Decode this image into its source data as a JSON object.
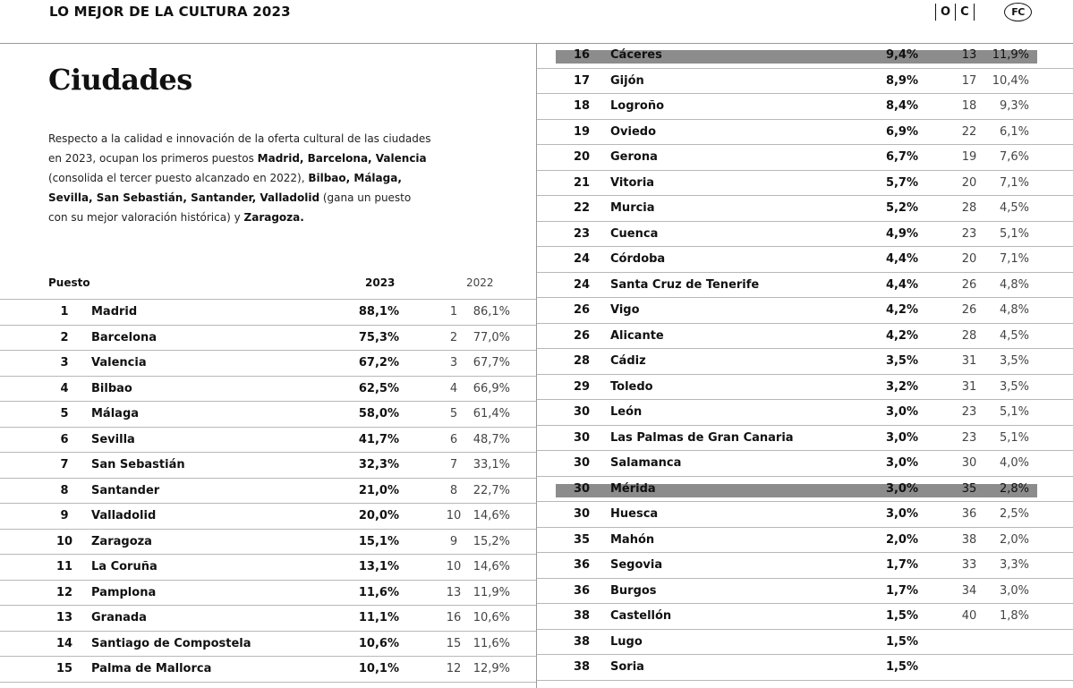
{
  "header": {
    "title": "LO MEJOR DE LA CULTURA 2023",
    "logo_occ": [
      "O",
      "C"
    ],
    "logo_fc": "FC"
  },
  "page": {
    "title": "Ciudades",
    "intro": [
      {
        "t": "Respecto a la calidad e innovación de la oferta cultural de las ciudades en 2023, ocupan los primeros puestos ",
        "b": false
      },
      {
        "t": "Madrid, Barcelona, Valencia",
        "b": true
      },
      {
        "t": " (consolida el tercer puesto alcanzado en 2022), ",
        "b": false
      },
      {
        "t": "Bilbao, Málaga, Sevilla, San Sebastián, Santander, Valladolid",
        "b": true
      },
      {
        "t": " (gana un puesto con su mejor valoración histórica) y ",
        "b": false
      },
      {
        "t": "Zaragoza.",
        "b": true
      }
    ]
  },
  "table": {
    "headers": {
      "rank": "Puesto",
      "y2023": "2023",
      "y2022": "2022"
    },
    "left": [
      {
        "rank": "1",
        "city": "Madrid",
        "pct": "88,1%",
        "prank": "1",
        "ppct": "86,1%"
      },
      {
        "rank": "2",
        "city": "Barcelona",
        "pct": "75,3%",
        "prank": "2",
        "ppct": "77,0%"
      },
      {
        "rank": "3",
        "city": "Valencia",
        "pct": "67,2%",
        "prank": "3",
        "ppct": "67,7%"
      },
      {
        "rank": "4",
        "city": "Bilbao",
        "pct": "62,5%",
        "prank": "4",
        "ppct": "66,9%"
      },
      {
        "rank": "5",
        "city": "Málaga",
        "pct": "58,0%",
        "prank": "5",
        "ppct": "61,4%"
      },
      {
        "rank": "6",
        "city": "Sevilla",
        "pct": "41,7%",
        "prank": "6",
        "ppct": "48,7%"
      },
      {
        "rank": "7",
        "city": "San Sebastián",
        "pct": "32,3%",
        "prank": "7",
        "ppct": "33,1%"
      },
      {
        "rank": "8",
        "city": "Santander",
        "pct": "21,0%",
        "prank": "8",
        "ppct": "22,7%"
      },
      {
        "rank": "9",
        "city": "Valladolid",
        "pct": "20,0%",
        "prank": "10",
        "ppct": "14,6%"
      },
      {
        "rank": "10",
        "city": "Zaragoza",
        "pct": "15,1%",
        "prank": "9",
        "ppct": "15,2%"
      },
      {
        "rank": "11",
        "city": "La Coruña",
        "pct": "13,1%",
        "prank": "10",
        "ppct": "14,6%"
      },
      {
        "rank": "12",
        "city": "Pamplona",
        "pct": "11,6%",
        "prank": "13",
        "ppct": "11,9%"
      },
      {
        "rank": "13",
        "city": "Granada",
        "pct": "11,1%",
        "prank": "16",
        "ppct": "10,6%"
      },
      {
        "rank": "14",
        "city": "Santiago de Compostela",
        "pct": "10,6%",
        "prank": "15",
        "ppct": "11,6%"
      },
      {
        "rank": "15",
        "city": "Palma de Mallorca",
        "pct": "10,1%",
        "prank": "12",
        "ppct": "12,9%"
      }
    ],
    "right": [
      {
        "rank": "16",
        "city": "Cáceres",
        "pct": "9,4%",
        "prank": "13",
        "ppct": "11,9%",
        "highlight": true
      },
      {
        "rank": "17",
        "city": "Gijón",
        "pct": "8,9%",
        "prank": "17",
        "ppct": "10,4%"
      },
      {
        "rank": "18",
        "city": "Logroño",
        "pct": "8,4%",
        "prank": "18",
        "ppct": "9,3%"
      },
      {
        "rank": "19",
        "city": "Oviedo",
        "pct": "6,9%",
        "prank": "22",
        "ppct": "6,1%"
      },
      {
        "rank": "20",
        "city": "Gerona",
        "pct": "6,7%",
        "prank": "19",
        "ppct": "7,6%"
      },
      {
        "rank": "21",
        "city": "Vitoria",
        "pct": "5,7%",
        "prank": "20",
        "ppct": "7,1%"
      },
      {
        "rank": "22",
        "city": "Murcia",
        "pct": "5,2%",
        "prank": "28",
        "ppct": "4,5%"
      },
      {
        "rank": "23",
        "city": "Cuenca",
        "pct": "4,9%",
        "prank": "23",
        "ppct": "5,1%"
      },
      {
        "rank": "24",
        "city": "Córdoba",
        "pct": "4,4%",
        "prank": "20",
        "ppct": "7,1%"
      },
      {
        "rank": "24",
        "city": "Santa Cruz de Tenerife",
        "pct": "4,4%",
        "prank": "26",
        "ppct": "4,8%"
      },
      {
        "rank": "26",
        "city": "Vigo",
        "pct": "4,2%",
        "prank": "26",
        "ppct": "4,8%"
      },
      {
        "rank": "26",
        "city": "Alicante",
        "pct": "4,2%",
        "prank": "28",
        "ppct": "4,5%"
      },
      {
        "rank": "28",
        "city": "Cádiz",
        "pct": "3,5%",
        "prank": "31",
        "ppct": "3,5%"
      },
      {
        "rank": "29",
        "city": "Toledo",
        "pct": "3,2%",
        "prank": "31",
        "ppct": "3,5%"
      },
      {
        "rank": "30",
        "city": "León",
        "pct": "3,0%",
        "prank": "23",
        "ppct": "5,1%"
      },
      {
        "rank": "30",
        "city": "Las Palmas de Gran Canaria",
        "pct": "3,0%",
        "prank": "23",
        "ppct": "5,1%"
      },
      {
        "rank": "30",
        "city": "Salamanca",
        "pct": "3,0%",
        "prank": "30",
        "ppct": "4,0%"
      },
      {
        "rank": "30",
        "city": "Mérida",
        "pct": "3,0%",
        "prank": "35",
        "ppct": "2,8%",
        "highlight": true
      },
      {
        "rank": "30",
        "city": "Huesca",
        "pct": "3,0%",
        "prank": "36",
        "ppct": "2,5%"
      },
      {
        "rank": "35",
        "city": "Mahón",
        "pct": "2,0%",
        "prank": "38",
        "ppct": "2,0%"
      },
      {
        "rank": "36",
        "city": "Segovia",
        "pct": "1,7%",
        "prank": "33",
        "ppct": "3,3%"
      },
      {
        "rank": "36",
        "city": "Burgos",
        "pct": "1,7%",
        "prank": "34",
        "ppct": "3,0%"
      },
      {
        "rank": "38",
        "city": "Castellón",
        "pct": "1,5%",
        "prank": "40",
        "ppct": "1,8%"
      },
      {
        "rank": "38",
        "city": "Lugo",
        "pct": "1,5%",
        "prank": "",
        "ppct": ""
      },
      {
        "rank": "38",
        "city": "Soria",
        "pct": "1,5%",
        "prank": "",
        "ppct": ""
      }
    ]
  }
}
